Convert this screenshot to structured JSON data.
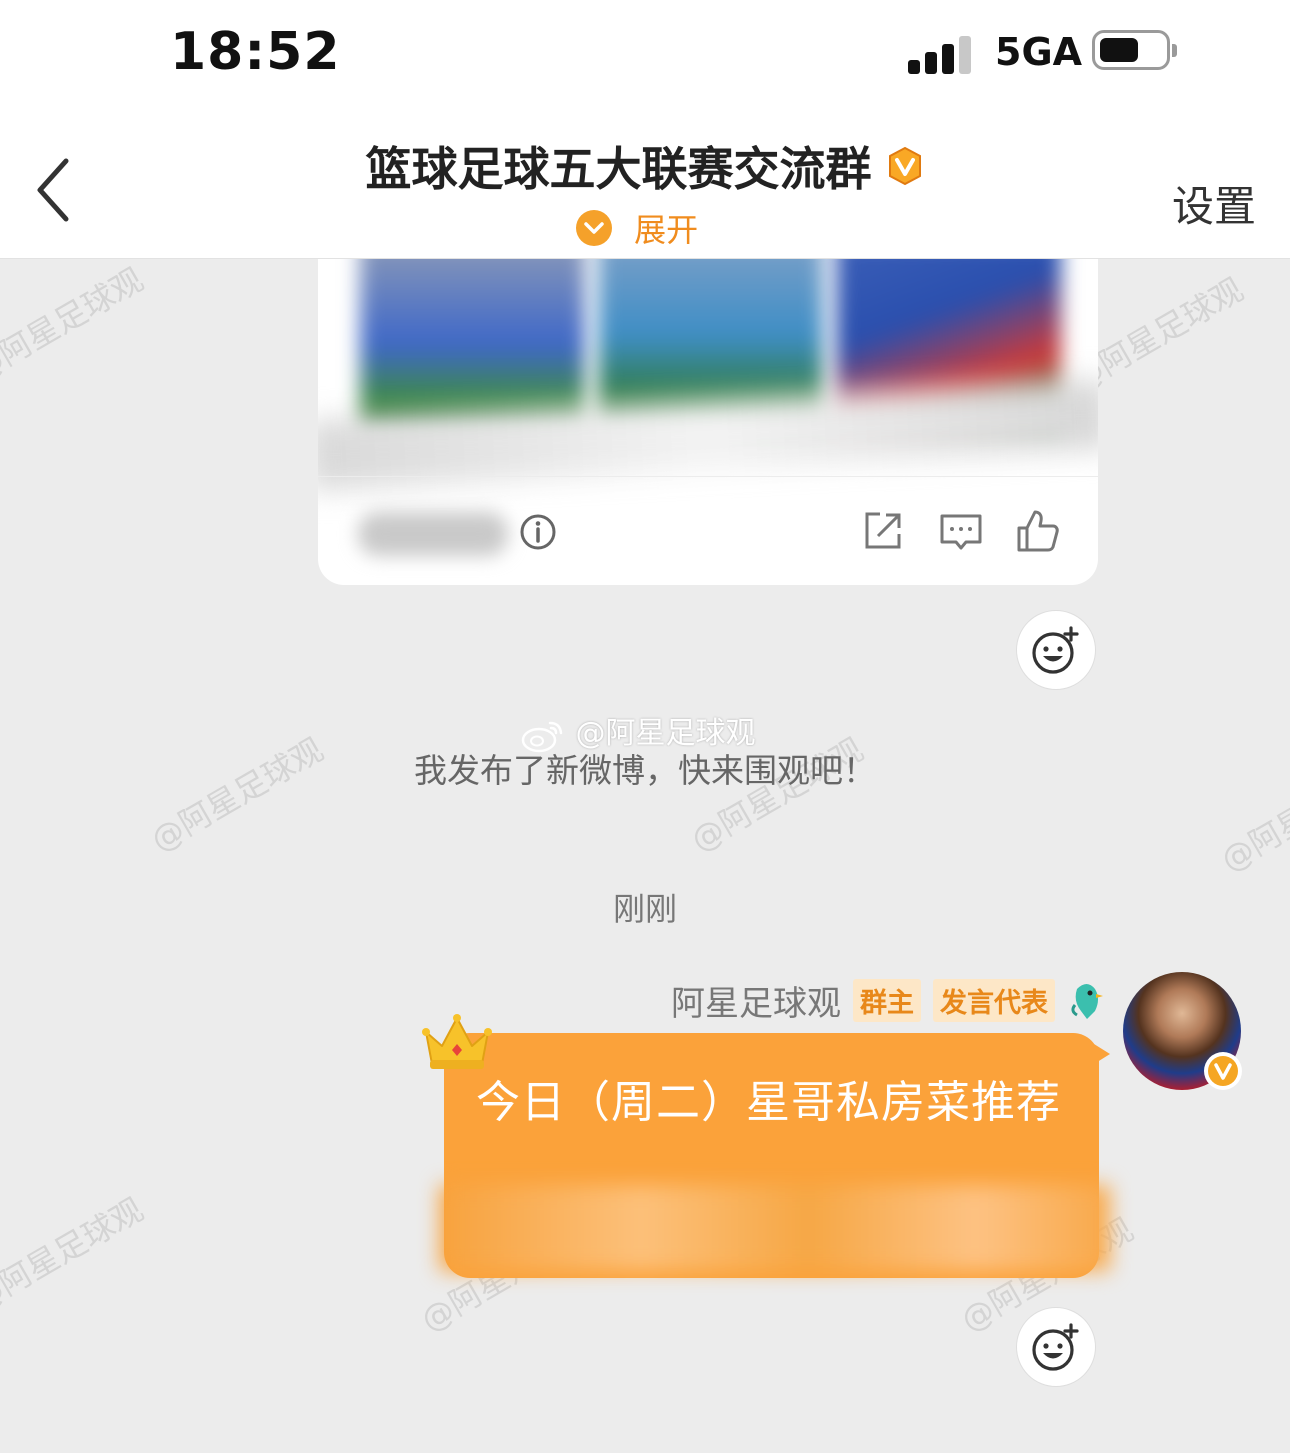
{
  "status_bar": {
    "time": "18:52",
    "network": "5GA"
  },
  "header": {
    "title": "篮球足球五大联赛交流群",
    "expand_label": "展开",
    "settings_label": "设置"
  },
  "watermark": "@阿星足球观",
  "share_notice": {
    "handle": "@阿星足球观",
    "text": "我发布了新微博，快来围观吧！"
  },
  "timestamp": "刚刚",
  "message": {
    "sender": "阿星足球观",
    "badges": [
      "群主",
      "发言代表"
    ],
    "text": "今日（周二）星哥私房菜推荐"
  },
  "colors": {
    "accent": "#fba23a",
    "badge_text": "#e8881a",
    "badge_bg": "#fde7c7"
  }
}
